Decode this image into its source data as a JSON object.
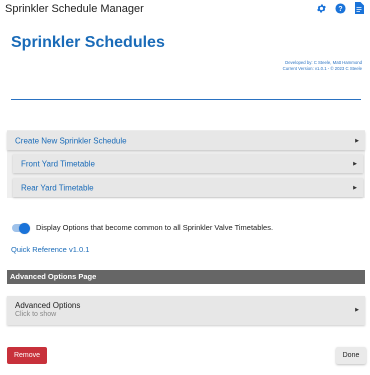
{
  "app": {
    "title": "Sprinkler Schedule Manager"
  },
  "icons": {
    "settings": "gear-icon",
    "help": "help-icon",
    "docs": "document-icon",
    "accent": "#1a73d9"
  },
  "header": {
    "title": "Sprinkler Schedules",
    "credits_line1": "Developed by: C Steele, Matt Hammond",
    "credits_line2": "Current Version: v1.0.1 -  © 2023 C Steele"
  },
  "sections": {
    "create_label": "Create New Sprinkler Schedule",
    "timetables": [
      {
        "label": "Front Yard Timetable"
      },
      {
        "label": "Rear Yard Timetable"
      }
    ],
    "arrow_glyph": "▶"
  },
  "options": {
    "toggle_label": "Display Options that become common to all Sprinkler Valve Timetables.",
    "toggle_on": true,
    "quick_reference": "Quick Reference v1.0.1"
  },
  "advanced": {
    "header": "Advanced Options Page",
    "row_title": "Advanced Options",
    "row_subtitle": "Click to show"
  },
  "buttons": {
    "remove": "Remove",
    "done": "Done",
    "remove_color": "#c8313b"
  }
}
